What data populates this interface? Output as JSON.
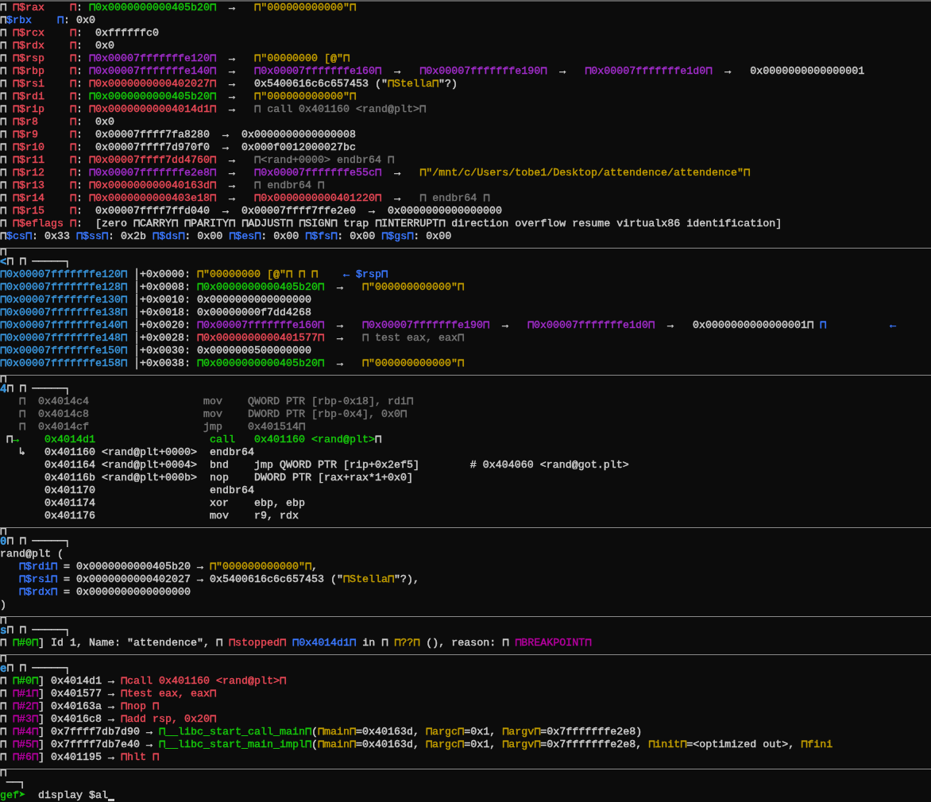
{
  "terminal": {
    "lines": [
      {
        "kind": "line",
        "segments": [
          {
            "text": "⊓ "
          },
          {
            "text": "⊓$rax    ⊓",
            "color": "#e74856"
          },
          {
            "text": ": "
          },
          {
            "text": "⊓0x0000000000405b20⊓",
            "color": "#16c60c"
          },
          {
            "text": "  →   "
          },
          {
            "text": "⊓\"000000000000\"⊓",
            "color": "#c19c00"
          }
        ]
      },
      {
        "kind": "line",
        "segments": [
          {
            "text": "⊓"
          },
          {
            "text": "$rbx    ⊓",
            "color": "#3b78ff"
          },
          {
            "text": ": 0x0"
          }
        ]
      },
      {
        "kind": "line",
        "segments": [
          {
            "text": "⊓ "
          },
          {
            "text": "⊓$rcx    ⊓",
            "color": "#e74856"
          },
          {
            "text": ":  0xffffffc0"
          }
        ]
      },
      {
        "kind": "line",
        "segments": [
          {
            "text": "⊓ "
          },
          {
            "text": "⊓$rdx    ⊓",
            "color": "#e74856"
          },
          {
            "text": ":  0x0"
          }
        ]
      },
      {
        "kind": "line",
        "segments": [
          {
            "text": "⊓ "
          },
          {
            "text": "⊓$rsp    ⊓",
            "color": "#e74856"
          },
          {
            "text": ": "
          },
          {
            "text": "⊓0x00007fffffffe120⊓",
            "color": "#a02dc9"
          },
          {
            "text": "  →   "
          },
          {
            "text": "⊓\"00000000 [@\"⊓",
            "color": "#c19c00"
          }
        ]
      },
      {
        "kind": "line",
        "segments": [
          {
            "text": "⊓ "
          },
          {
            "text": "⊓$rbp    ⊓",
            "color": "#e74856"
          },
          {
            "text": ": "
          },
          {
            "text": "⊓0x00007fffffffe140⊓",
            "color": "#a02dc9"
          },
          {
            "text": "  →   "
          },
          {
            "text": "⊓0x00007fffffffe160⊓",
            "color": "#a02dc9"
          },
          {
            "text": "  →   "
          },
          {
            "text": "⊓0x00007fffffffe190⊓",
            "color": "#a02dc9"
          },
          {
            "text": "  →   "
          },
          {
            "text": "⊓0x00007fffffffe1d0⊓",
            "color": "#a02dc9"
          },
          {
            "text": "  →   0x0000000000000001"
          }
        ]
      },
      {
        "kind": "line",
        "segments": [
          {
            "text": "⊓ "
          },
          {
            "text": "⊓$rsi    ⊓",
            "color": "#e74856"
          },
          {
            "text": ": "
          },
          {
            "text": "⊓0x0000000000402027⊓",
            "color": "#e74856"
          },
          {
            "text": "  →   0x5400616c6c657453 (\""
          },
          {
            "text": "⊓Stella⊓",
            "color": "#c19c00"
          },
          {
            "text": "\"?)"
          }
        ]
      },
      {
        "kind": "line",
        "segments": [
          {
            "text": "⊓ "
          },
          {
            "text": "⊓$rdi    ⊓",
            "color": "#e74856"
          },
          {
            "text": ": "
          },
          {
            "text": "⊓0x0000000000405b20⊓",
            "color": "#16c60c"
          },
          {
            "text": "  →   "
          },
          {
            "text": "⊓\"000000000000\"⊓",
            "color": "#c19c00"
          }
        ]
      },
      {
        "kind": "line",
        "segments": [
          {
            "text": "⊓ "
          },
          {
            "text": "⊓$rip    ⊓",
            "color": "#e74856"
          },
          {
            "text": ": "
          },
          {
            "text": "⊓0x00000000004014d1⊓",
            "color": "#e74856"
          },
          {
            "text": "  →   "
          },
          {
            "text": "⊓ call 0x401160 <rand@plt>⊓",
            "color": "#767676"
          }
        ]
      },
      {
        "kind": "line",
        "segments": [
          {
            "text": "⊓ "
          },
          {
            "text": "⊓$r8     ⊓",
            "color": "#e74856"
          },
          {
            "text": ":  0x0"
          }
        ]
      },
      {
        "kind": "line",
        "segments": [
          {
            "text": "⊓ "
          },
          {
            "text": "⊓$r9     ⊓",
            "color": "#e74856"
          },
          {
            "text": ":  0x00007ffff7fa8280  →  0x0000000000000008"
          }
        ]
      },
      {
        "kind": "line",
        "segments": [
          {
            "text": "⊓ "
          },
          {
            "text": "⊓$r10    ⊓",
            "color": "#e74856"
          },
          {
            "text": ":  0x00007ffff7d970f0  →  0x000f0012000027bc"
          }
        ]
      },
      {
        "kind": "line",
        "segments": [
          {
            "text": "⊓ "
          },
          {
            "text": "⊓$r11    ⊓",
            "color": "#e74856"
          },
          {
            "text": ": "
          },
          {
            "text": "⊓0x00007ffff7dd4760⊓",
            "color": "#e74856"
          },
          {
            "text": "  →   "
          },
          {
            "text": "⊓<rand+0000> endbr64 ⊓",
            "color": "#767676"
          }
        ]
      },
      {
        "kind": "line",
        "segments": [
          {
            "text": "⊓ "
          },
          {
            "text": "⊓$r12    ⊓",
            "color": "#e74856"
          },
          {
            "text": ": "
          },
          {
            "text": "⊓0x00007fffffffe2e8⊓",
            "color": "#a02dc9"
          },
          {
            "text": "  →   "
          },
          {
            "text": "⊓0x00007fffffffe55c⊓",
            "color": "#a02dc9"
          },
          {
            "text": "  →   "
          },
          {
            "text": "⊓\"/mnt/c/Users/tobe1/Desktop/attendence/attendence\"⊓",
            "color": "#c19c00"
          }
        ]
      },
      {
        "kind": "line",
        "segments": [
          {
            "text": "⊓ "
          },
          {
            "text": "⊓$r13    ⊓",
            "color": "#e74856"
          },
          {
            "text": ": "
          },
          {
            "text": "⊓0x000000000040163d⊓",
            "color": "#e74856"
          },
          {
            "text": "  →   "
          },
          {
            "text": "⊓ endbr64 ⊓",
            "color": "#767676"
          }
        ]
      },
      {
        "kind": "line",
        "segments": [
          {
            "text": "⊓ "
          },
          {
            "text": "⊓$r14    ⊓",
            "color": "#e74856"
          },
          {
            "text": ": "
          },
          {
            "text": "⊓0x0000000000403e18⊓",
            "color": "#e74856"
          },
          {
            "text": "  →   "
          },
          {
            "text": "⊓0x0000000000401220⊓",
            "color": "#e74856"
          },
          {
            "text": "  →   "
          },
          {
            "text": "⊓ endbr64 ⊓",
            "color": "#767676"
          }
        ]
      },
      {
        "kind": "line",
        "segments": [
          {
            "text": "⊓ "
          },
          {
            "text": "⊓$r15    ⊓",
            "color": "#e74856"
          },
          {
            "text": ":  0x00007ffff7ffd040  →  0x00007ffff7ffe2e0  →  0x0000000000000000"
          }
        ]
      },
      {
        "kind": "line",
        "segments": [
          {
            "text": "⊓ "
          },
          {
            "text": "⊓$eflags ⊓",
            "color": "#e74856"
          },
          {
            "text": ":  [zero ⊓CARRY⊓ ⊓PARITY⊓ ⊓ADJUST⊓ ⊓SIGN⊓ trap ⊓INTERRUPT⊓ direction overflow resume virtualx86 identification]"
          }
        ]
      },
      {
        "kind": "line",
        "segments": [
          {
            "text": "⊓"
          },
          {
            "text": "$cs⊓",
            "color": "#3b78ff"
          },
          {
            "text": ": 0x33 "
          },
          {
            "text": "⊓$ss⊓",
            "color": "#3b78ff"
          },
          {
            "text": ": 0x2b "
          },
          {
            "text": "⊓$ds⊓",
            "color": "#3b78ff"
          },
          {
            "text": ": 0x00 "
          },
          {
            "text": "⊓$es⊓",
            "color": "#3b78ff"
          },
          {
            "text": ": 0x00 "
          },
          {
            "text": "⊓$fs⊓",
            "color": "#3b78ff"
          },
          {
            "text": ": 0x00 "
          },
          {
            "text": "⊓$gs⊓",
            "color": "#3b78ff"
          },
          {
            "text": ": 0x00"
          }
        ]
      },
      {
        "kind": "rule",
        "segments": [
          {
            "text": "⊓"
          }
        ]
      },
      {
        "kind": "header",
        "segments": [
          {
            "text": "<",
            "color": "#3a96dd"
          },
          {
            "text": "⊓ ⊓ ─────┐"
          }
        ]
      },
      {
        "kind": "line",
        "segments": [
          {
            "text": "⊓0x00007fffffffe120⊓",
            "color": "#3a96dd"
          },
          {
            "text": " │+0x0000: "
          },
          {
            "text": "⊓\"00000000 [@\"⊓ ⊓ ⊓",
            "color": "#c19c00"
          },
          {
            "text": "    ← $rsp⊓",
            "color": "#3b78ff"
          }
        ]
      },
      {
        "kind": "line",
        "segments": [
          {
            "text": "⊓0x00007fffffffe128⊓",
            "color": "#3a96dd"
          },
          {
            "text": " │+0x0008: "
          },
          {
            "text": "⊓0x0000000000405b20⊓",
            "color": "#16c60c"
          },
          {
            "text": "  →   "
          },
          {
            "text": "⊓\"000000000000\"⊓",
            "color": "#c19c00"
          }
        ]
      },
      {
        "kind": "line",
        "segments": [
          {
            "text": "⊓0x00007fffffffe130⊓",
            "color": "#3a96dd"
          },
          {
            "text": " │+0x0010: 0x0000000000000000"
          }
        ]
      },
      {
        "kind": "line",
        "segments": [
          {
            "text": "⊓0x00007fffffffe138⊓",
            "color": "#3a96dd"
          },
          {
            "text": " │+0x0018: 0x00000000f7dd4268"
          }
        ]
      },
      {
        "kind": "line",
        "segments": [
          {
            "text": "⊓0x00007fffffffe140⊓",
            "color": "#3a96dd"
          },
          {
            "text": " │+0x0020: "
          },
          {
            "text": "⊓0x00007fffffffe160⊓",
            "color": "#a02dc9"
          },
          {
            "text": "  →   "
          },
          {
            "text": "⊓0x00007fffffffe190⊓",
            "color": "#a02dc9"
          },
          {
            "text": "  →   "
          },
          {
            "text": "⊓0x00007fffffffe1d0⊓",
            "color": "#a02dc9"
          },
          {
            "text": "  →   0x0000000000000001⊓ "
          },
          {
            "text": "⊓          ←",
            "color": "#3b78ff"
          }
        ]
      },
      {
        "kind": "line",
        "segments": [
          {
            "text": "⊓0x00007fffffffe148⊓",
            "color": "#3a96dd"
          },
          {
            "text": " │+0x0028: "
          },
          {
            "text": "⊓0x0000000000401577⊓",
            "color": "#e74856"
          },
          {
            "text": "  →   "
          },
          {
            "text": "⊓ test eax, eax⊓",
            "color": "#767676"
          }
        ]
      },
      {
        "kind": "line",
        "segments": [
          {
            "text": "⊓0x00007fffffffe150⊓",
            "color": "#3a96dd"
          },
          {
            "text": " │+0x0030: 0x0000000500000000"
          }
        ]
      },
      {
        "kind": "line",
        "segments": [
          {
            "text": "⊓0x00007fffffffe158⊓",
            "color": "#3a96dd"
          },
          {
            "text": " │+0x0038: "
          },
          {
            "text": "⊓0x0000000000405b20⊓",
            "color": "#16c60c"
          },
          {
            "text": "  →   "
          },
          {
            "text": "⊓\"000000000000\"⊓",
            "color": "#c19c00"
          }
        ]
      },
      {
        "kind": "rule",
        "segments": [
          {
            "text": "⊓"
          }
        ]
      },
      {
        "kind": "header",
        "segments": [
          {
            "text": "4",
            "color": "#3a96dd"
          },
          {
            "text": "⊓ ⊓ ─────┐"
          }
        ]
      },
      {
        "kind": "line",
        "segments": [
          {
            "text": "   ⊓  0x4014c4                  mov    QWORD PTR [rbp-0x18], rdi⊓",
            "color": "#767676"
          }
        ]
      },
      {
        "kind": "line",
        "segments": [
          {
            "text": "   ⊓  0x4014c8                  mov    DWORD PTR [rbp-0x4], 0x0⊓",
            "color": "#767676"
          }
        ]
      },
      {
        "kind": "line",
        "segments": [
          {
            "text": "   ⊓  0x4014cf                  jmp    0x401514⊓",
            "color": "#767676"
          }
        ]
      },
      {
        "kind": "line",
        "segments": [
          {
            "text": " ⊓"
          },
          {
            "text": "→    0x4014d1                  call   0x401160 <rand@plt>",
            "color": "#16c60c"
          },
          {
            "text": "⊓"
          }
        ]
      },
      {
        "kind": "line",
        "segments": [
          {
            "text": "   ↳   0x401160 <rand@plt+0000>  endbr64"
          }
        ]
      },
      {
        "kind": "line",
        "segments": [
          {
            "text": "       0x401164 <rand@plt+0004>  bnd    jmp QWORD PTR [rip+0x2ef5]        # 0x404060 <rand@got.plt>"
          }
        ]
      },
      {
        "kind": "line",
        "segments": [
          {
            "text": "       0x40116b <rand@plt+000b>  nop    DWORD PTR [rax+rax*1+0x0]"
          }
        ]
      },
      {
        "kind": "line",
        "segments": [
          {
            "text": "       0x401170                  endbr64"
          }
        ]
      },
      {
        "kind": "line",
        "segments": [
          {
            "text": "       0x401174                  xor    ebp, ebp"
          }
        ]
      },
      {
        "kind": "line",
        "segments": [
          {
            "text": "       0x401176                  mov    r9, rdx"
          }
        ]
      },
      {
        "kind": "rule",
        "segments": [
          {
            "text": "⊓"
          }
        ]
      },
      {
        "kind": "header",
        "segments": [
          {
            "text": "0",
            "color": "#3a96dd"
          },
          {
            "text": "⊓ ⊓ ─────┐"
          }
        ]
      },
      {
        "kind": "line",
        "segments": [
          {
            "text": "rand@plt ("
          }
        ]
      },
      {
        "kind": "line",
        "segments": [
          {
            "text": "   ⊓$rdi⊓",
            "color": "#3b78ff"
          },
          {
            "text": " = 0x0000000000405b20 → "
          },
          {
            "text": "⊓\"000000000000\"⊓",
            "color": "#c19c00"
          },
          {
            "text": ","
          }
        ]
      },
      {
        "kind": "line",
        "segments": [
          {
            "text": "   ⊓$rsi⊓",
            "color": "#3b78ff"
          },
          {
            "text": " = 0x0000000000402027 → 0x5400616c6c657453 (\""
          },
          {
            "text": "⊓Stella⊓",
            "color": "#c19c00"
          },
          {
            "text": "\"?),"
          }
        ]
      },
      {
        "kind": "line",
        "segments": [
          {
            "text": "   ⊓$rdx⊓",
            "color": "#3b78ff"
          },
          {
            "text": " = 0x0000000000000000"
          }
        ]
      },
      {
        "kind": "line",
        "segments": [
          {
            "text": ")"
          }
        ]
      },
      {
        "kind": "rule",
        "segments": [
          {
            "text": "⊓"
          }
        ]
      },
      {
        "kind": "header",
        "segments": [
          {
            "text": "s",
            "color": "#3a96dd"
          },
          {
            "text": "⊓ ⊓ ─────┐"
          }
        ]
      },
      {
        "kind": "line",
        "segments": [
          {
            "text": "⊓ "
          },
          {
            "text": "⊓#0⊓",
            "color": "#16c60c"
          },
          {
            "text": "] Id 1, Name: \"attendence\", ⊓ "
          },
          {
            "text": "⊓stopped⊓",
            "color": "#e74856"
          },
          {
            "text": " ⊓0x4014d1⊓",
            "color": "#3b78ff"
          },
          {
            "text": " in ⊓ "
          },
          {
            "text": "⊓??⊓",
            "color": "#c19c00"
          },
          {
            "text": " (), reason: ⊓ "
          },
          {
            "text": "⊓BREAKPOINT⊓",
            "color": "#b4009e"
          }
        ]
      },
      {
        "kind": "rule",
        "segments": [
          {
            "text": "⊓"
          }
        ]
      },
      {
        "kind": "header",
        "segments": [
          {
            "text": "e",
            "color": "#3a96dd"
          },
          {
            "text": "⊓ ⊓ ─────┐"
          }
        ]
      },
      {
        "kind": "line",
        "segments": [
          {
            "text": "⊓ "
          },
          {
            "text": "⊓#0⊓",
            "color": "#16c60c"
          },
          {
            "text": "] 0x4014d1 → "
          },
          {
            "text": "⊓call 0x401160 <rand@plt>⊓",
            "color": "#e74856"
          }
        ]
      },
      {
        "kind": "line",
        "segments": [
          {
            "text": "⊓ "
          },
          {
            "text": "⊓#1⊓",
            "color": "#b4009e"
          },
          {
            "text": "] 0x401577 → "
          },
          {
            "text": "⊓test eax, eax⊓",
            "color": "#e74856"
          }
        ]
      },
      {
        "kind": "line",
        "segments": [
          {
            "text": "⊓ "
          },
          {
            "text": "⊓#2⊓",
            "color": "#b4009e"
          },
          {
            "text": "] 0x40163a → "
          },
          {
            "text": "⊓nop ⊓",
            "color": "#e74856"
          }
        ]
      },
      {
        "kind": "line",
        "segments": [
          {
            "text": "⊓ "
          },
          {
            "text": "⊓#3⊓",
            "color": "#b4009e"
          },
          {
            "text": "] 0x4016c8 → "
          },
          {
            "text": "⊓add rsp, 0x20⊓",
            "color": "#e74856"
          }
        ]
      },
      {
        "kind": "line",
        "segments": [
          {
            "text": "⊓ "
          },
          {
            "text": "⊓#4⊓",
            "color": "#b4009e"
          },
          {
            "text": "] 0x7ffff7db7d90 → "
          },
          {
            "text": "⊓__libc_start_call_main⊓",
            "color": "#16c60c"
          },
          {
            "text": "("
          },
          {
            "text": "⊓main⊓",
            "color": "#c19c00"
          },
          {
            "text": "=0x40163d, "
          },
          {
            "text": "⊓argc⊓",
            "color": "#c19c00"
          },
          {
            "text": "=0x1, "
          },
          {
            "text": "⊓argv⊓",
            "color": "#c19c00"
          },
          {
            "text": "=0x7fffffffe2e8)"
          }
        ]
      },
      {
        "kind": "line",
        "segments": [
          {
            "text": "⊓ "
          },
          {
            "text": "⊓#5⊓",
            "color": "#b4009e"
          },
          {
            "text": "] 0x7ffff7db7e40 → "
          },
          {
            "text": "⊓__libc_start_main_impl⊓",
            "color": "#16c60c"
          },
          {
            "text": "("
          },
          {
            "text": "⊓main⊓",
            "color": "#c19c00"
          },
          {
            "text": "=0x40163d, "
          },
          {
            "text": "⊓argc⊓",
            "color": "#c19c00"
          },
          {
            "text": "=0x1, "
          },
          {
            "text": "⊓argv⊓",
            "color": "#c19c00"
          },
          {
            "text": "=0x7fffffffe2e8, "
          },
          {
            "text": "⊓init⊓",
            "color": "#c19c00"
          },
          {
            "text": "=<optimized out>, "
          },
          {
            "text": "⊓fini",
            "color": "#c19c00"
          }
        ]
      },
      {
        "kind": "line",
        "segments": [
          {
            "text": "⊓ "
          },
          {
            "text": "⊓#6⊓",
            "color": "#b4009e"
          },
          {
            "text": "] 0x401195 → "
          },
          {
            "text": "⊓hlt ⊓",
            "color": "#e74856"
          }
        ]
      },
      {
        "kind": "rule",
        "segments": [
          {
            "text": "⊓"
          }
        ]
      },
      {
        "kind": "line",
        "segments": [
          {
            "text": " ──┐"
          }
        ]
      },
      {
        "kind": "prompt",
        "segments": [
          {
            "text": "gef➤",
            "color": "#16c60c"
          },
          {
            "text": "  display $al"
          }
        ]
      }
    ]
  }
}
